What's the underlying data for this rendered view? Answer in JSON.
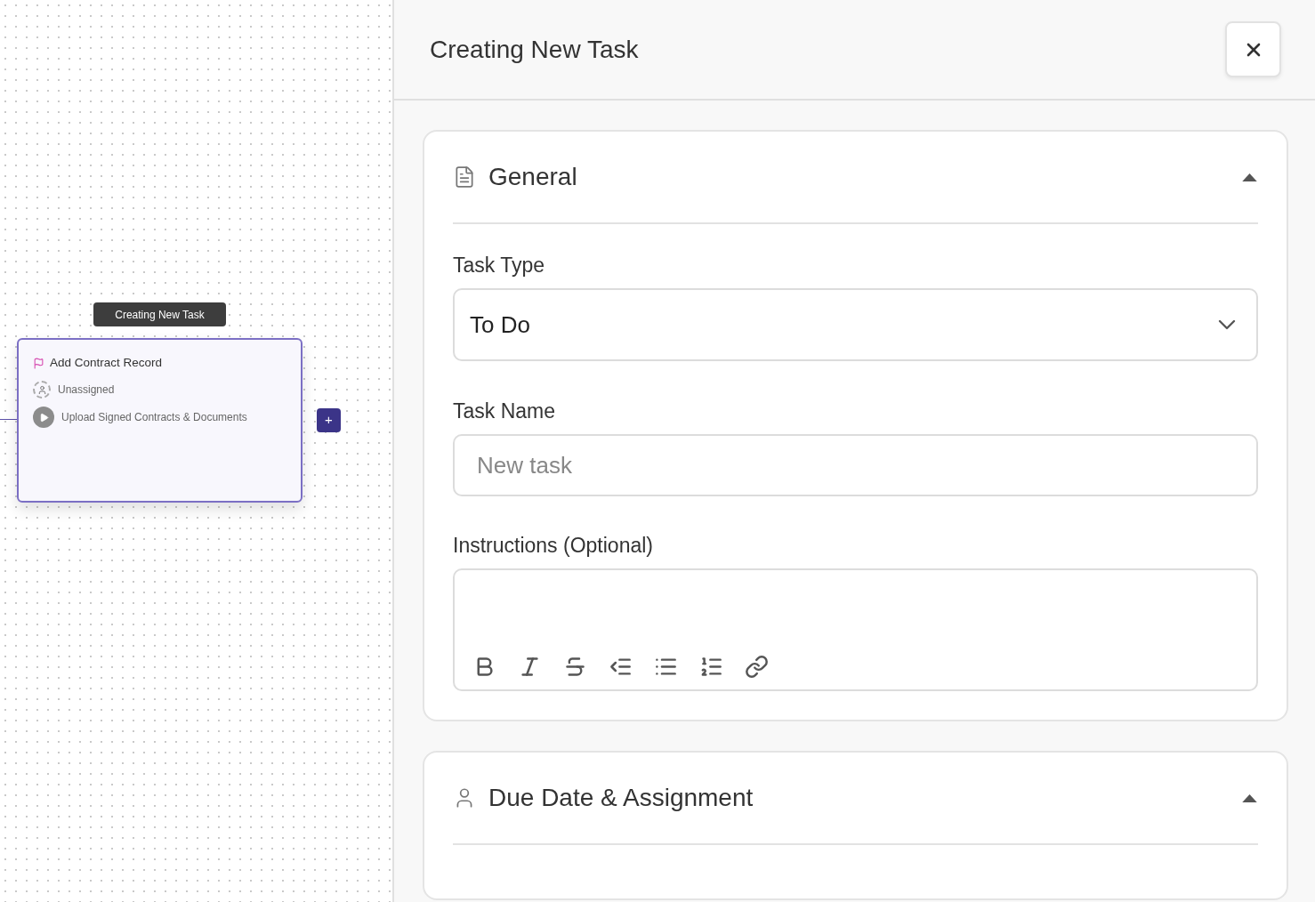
{
  "canvas": {
    "node": {
      "tooltip": "Creating New Task",
      "title": "Add Contract Record",
      "assignee": "Unassigned",
      "action": "Upload Signed Contracts & Documents",
      "selected": true
    },
    "add_button": "+"
  },
  "panel": {
    "title": "Creating New Task"
  },
  "sections": [
    {
      "kind": "general",
      "title": "General",
      "expanded": true,
      "fields": [
        {
          "kind": "select",
          "label": "Task Type",
          "value": "To Do"
        },
        {
          "kind": "text",
          "label": "Task Name",
          "placeholder": "New task"
        },
        {
          "kind": "editor",
          "label": "Instructions (Optional)"
        }
      ]
    },
    {
      "kind": "assignment",
      "title": "Due Date & Assignment",
      "expanded": true
    }
  ]
}
